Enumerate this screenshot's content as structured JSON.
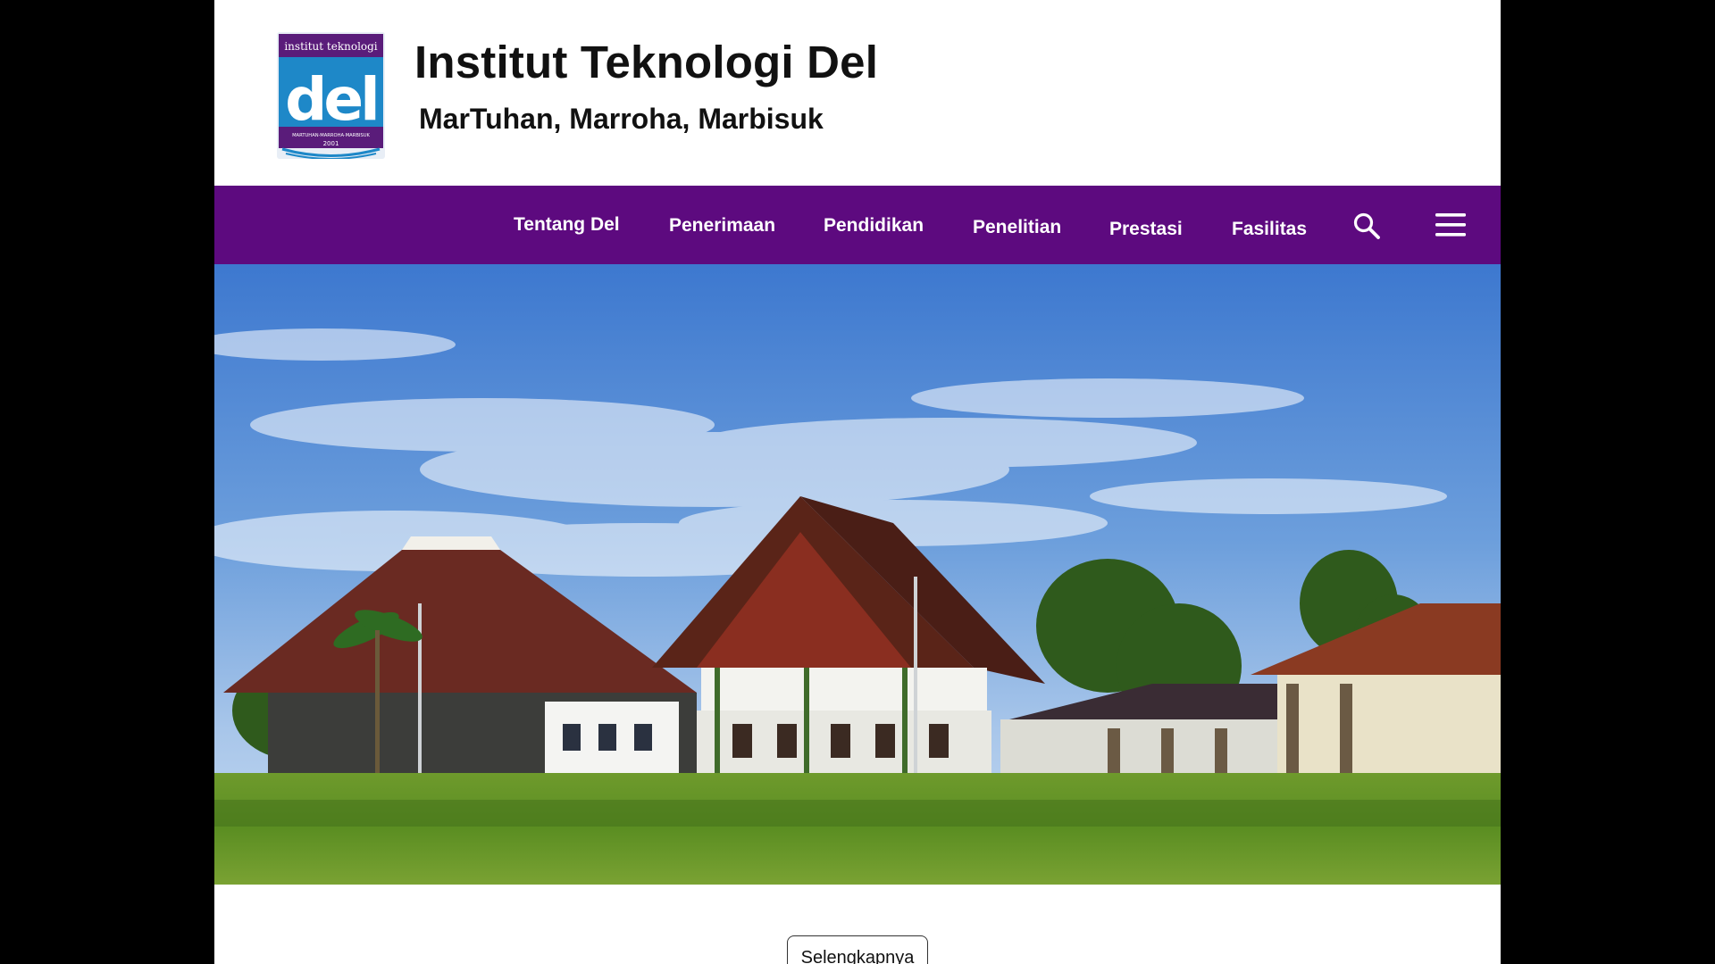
{
  "header": {
    "logo_text_top": "institut teknologi",
    "logo_text_main": "del",
    "logo_text_motto": "MARTUHAN·MARROHA·MARBISUK",
    "logo_text_year": "2001",
    "title": "Institut Teknologi Del",
    "tagline": "MarTuhan, Marroha, Marbisuk"
  },
  "nav": {
    "items": [
      {
        "label": "Tentang Del"
      },
      {
        "label": "Penerimaan"
      },
      {
        "label": "Pendidikan"
      },
      {
        "label": "Penelitian"
      },
      {
        "label": "Prestasi"
      },
      {
        "label": "Fasilitas"
      }
    ],
    "search_icon": "search-icon",
    "menu_icon": "hamburger-menu-icon"
  },
  "hero": {
    "image": "campus-photo"
  },
  "more_button": {
    "label": "Selengkapnya"
  },
  "colors": {
    "nav_bg": "#5d0a7f",
    "logo_purple": "#5a1c7a",
    "logo_blue": "#1e88c8"
  }
}
